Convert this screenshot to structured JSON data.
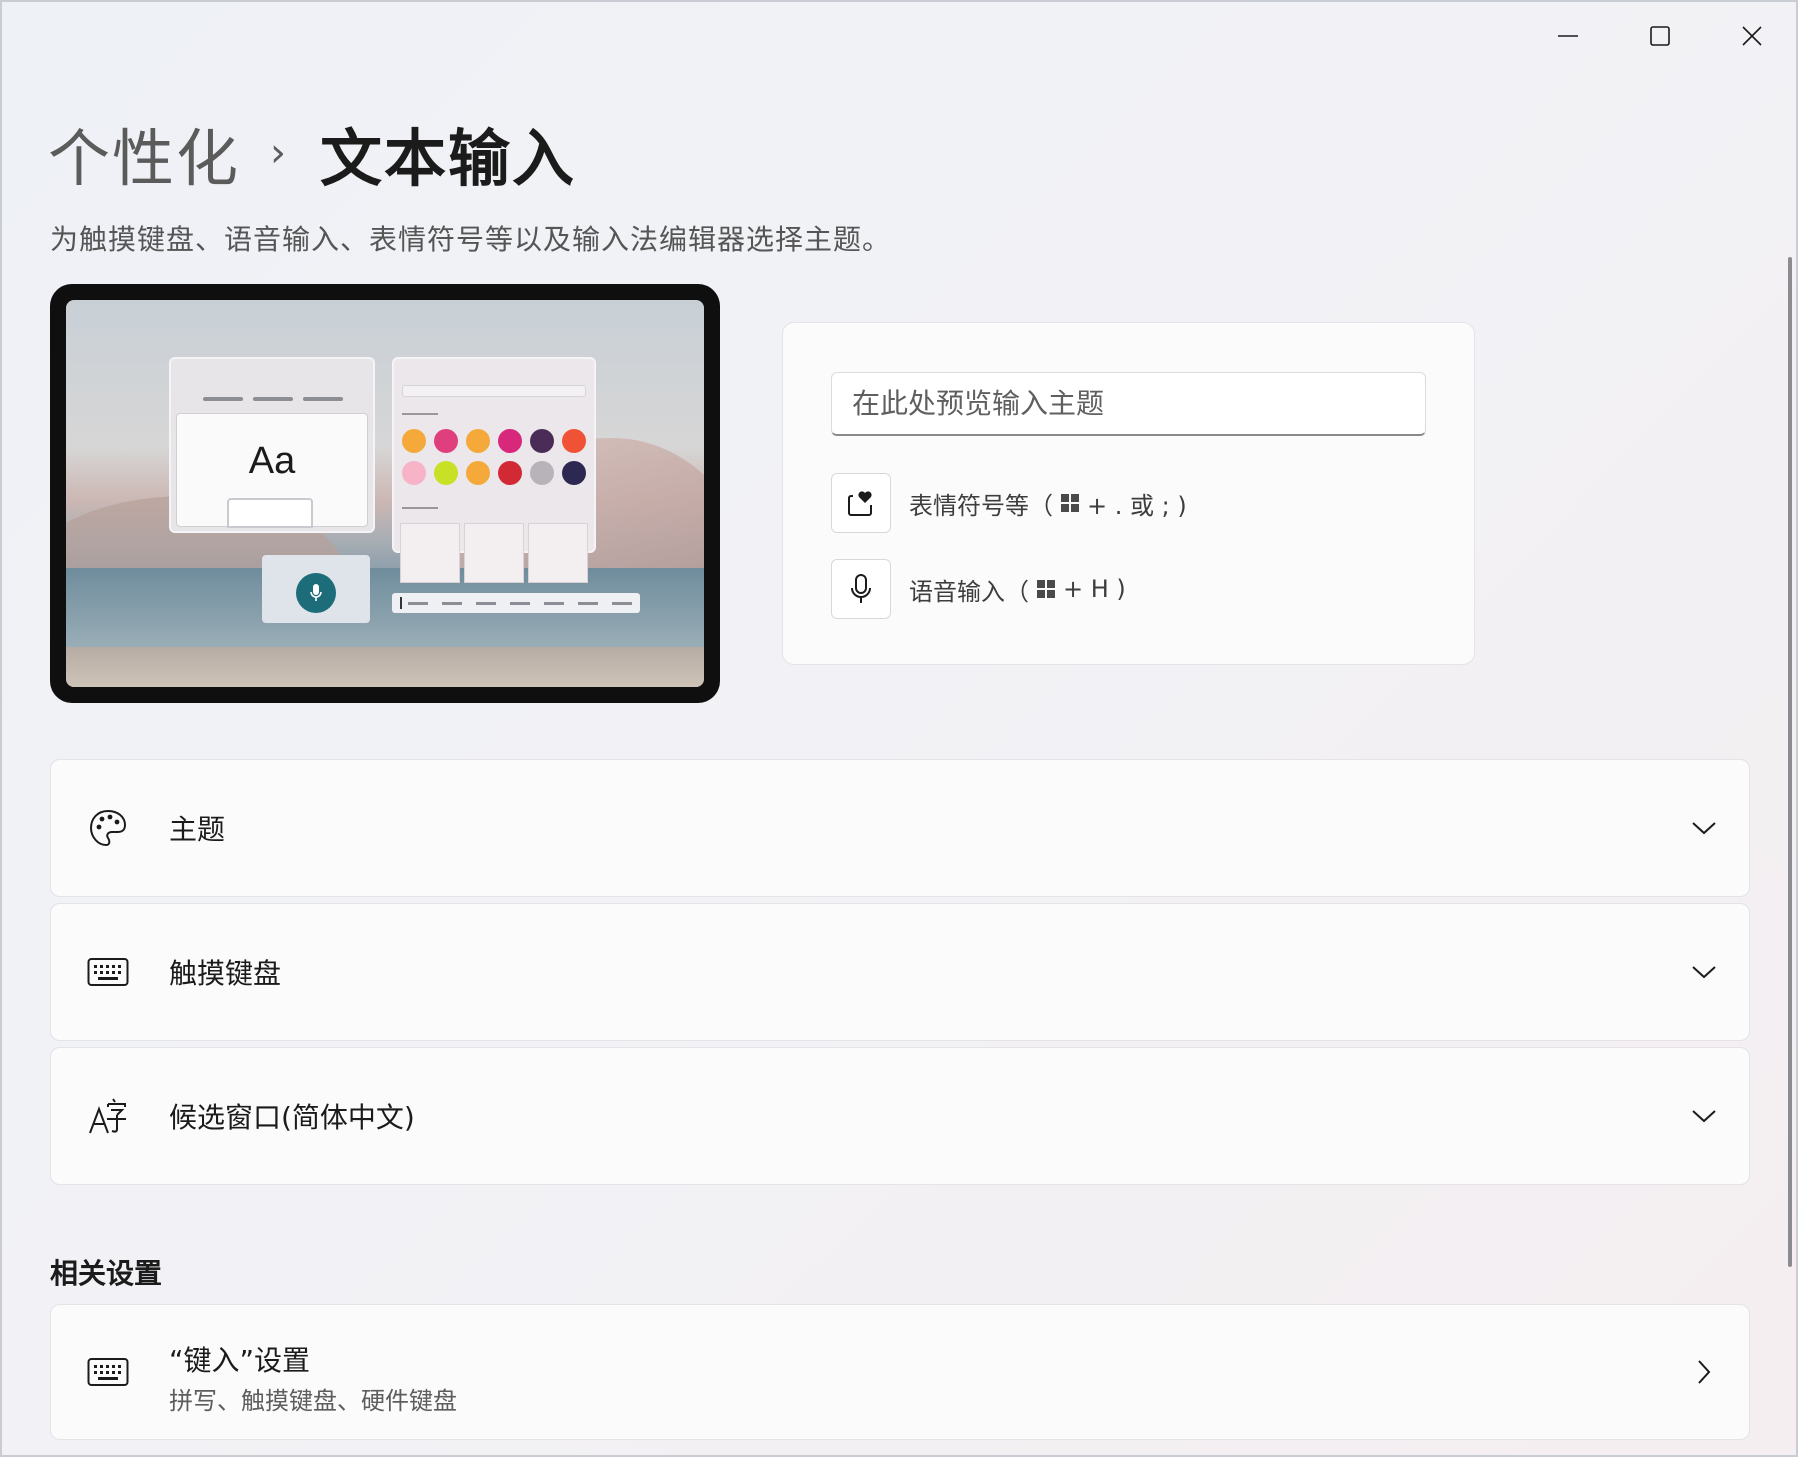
{
  "window": {
    "controls": {
      "minimize_icon": "minimize-icon",
      "maximize_icon": "maximize-icon",
      "close_icon": "close-icon"
    }
  },
  "breadcrumb": {
    "parent": "个性化",
    "separator": "›",
    "current": "文本输入"
  },
  "subtitle": "为触摸键盘、语音输入、表情符号等以及输入法编辑器选择主题。",
  "preview_image": {
    "keyboard_sample": "Aa",
    "emoji_colors": [
      "#f6a93b",
      "#e03f7e",
      "#f6a93b",
      "#d8287c",
      "#4b2c57",
      "#ef5234",
      "#f7b3c8",
      "#c8e026",
      "#f6a93b",
      "#d12a34",
      "#b7b3b8",
      "#2c2852"
    ]
  },
  "preview": {
    "input_placeholder": "在此处预览输入主题",
    "emoji_label": "表情符号等（",
    "emoji_shortcut": "+ . 或 ; )",
    "voice_label": "语音输入（",
    "voice_shortcut": "+ H )"
  },
  "settings": [
    {
      "icon": "palette-icon",
      "label": "主题"
    },
    {
      "icon": "keyboard-icon",
      "label": "触摸键盘"
    },
    {
      "icon": "candidate-window-icon",
      "label": "候选窗口(简体中文)"
    }
  ],
  "related": {
    "title": "相关设置",
    "typing": {
      "icon": "keyboard-icon",
      "label": "“键入”设置",
      "description": "拼写、触摸键盘、硬件键盘"
    }
  }
}
